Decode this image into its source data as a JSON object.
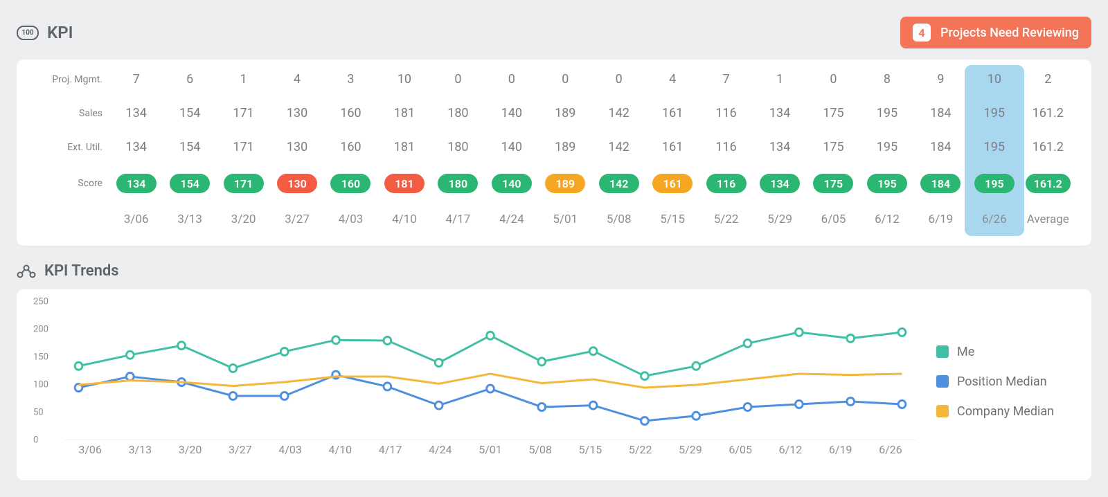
{
  "kpi_header": {
    "badge_text": "100",
    "title": "KPI"
  },
  "review": {
    "count": 4,
    "label": "Projects Need Reviewing"
  },
  "kpi_table": {
    "row_labels": [
      "Proj. Mgmt.",
      "Sales",
      "Ext. Util.",
      "Score",
      ""
    ],
    "dates": [
      "3/06",
      "3/13",
      "3/20",
      "3/27",
      "4/03",
      "4/10",
      "4/17",
      "4/24",
      "5/01",
      "5/08",
      "5/15",
      "5/22",
      "5/29",
      "6/05",
      "6/12",
      "6/19",
      "6/26"
    ],
    "average_label": "Average",
    "highlight_col": 16,
    "proj_mgmt": [
      7,
      6,
      1,
      4,
      3,
      10,
      0,
      0,
      0,
      0,
      4,
      7,
      1,
      0,
      8,
      9,
      10
    ],
    "proj_mgmt_avg": 2,
    "sales": [
      134,
      154,
      171,
      130,
      160,
      181,
      180,
      140,
      189,
      142,
      161,
      116,
      134,
      175,
      195,
      184,
      195
    ],
    "sales_avg": 161.2,
    "ext_util": [
      134,
      154,
      171,
      130,
      160,
      181,
      180,
      140,
      189,
      142,
      161,
      116,
      134,
      175,
      195,
      184,
      195
    ],
    "ext_util_avg": 161.2,
    "score": [
      {
        "v": 134,
        "c": "green"
      },
      {
        "v": 154,
        "c": "green"
      },
      {
        "v": 171,
        "c": "green"
      },
      {
        "v": 130,
        "c": "red"
      },
      {
        "v": 160,
        "c": "green"
      },
      {
        "v": 181,
        "c": "red"
      },
      {
        "v": 180,
        "c": "green"
      },
      {
        "v": 140,
        "c": "green"
      },
      {
        "v": 189,
        "c": "amber"
      },
      {
        "v": 142,
        "c": "green"
      },
      {
        "v": 161,
        "c": "amber"
      },
      {
        "v": 116,
        "c": "green"
      },
      {
        "v": 134,
        "c": "green"
      },
      {
        "v": 175,
        "c": "green"
      },
      {
        "v": 195,
        "c": "green"
      },
      {
        "v": 184,
        "c": "green"
      },
      {
        "v": 195,
        "c": "green"
      }
    ],
    "score_avg": {
      "v": 161.2,
      "c": "green"
    }
  },
  "trends_header": {
    "title": "KPI Trends"
  },
  "legend": {
    "me": "Me",
    "pos": "Position Median",
    "comp": "Company Median"
  },
  "chart_data": {
    "type": "line",
    "title": "KPI Trends",
    "xlabel": "",
    "ylabel": "",
    "ylim": [
      0,
      250
    ],
    "yticks": [
      0,
      50,
      100,
      150,
      200,
      250
    ],
    "categories": [
      "3/06",
      "3/13",
      "3/20",
      "3/27",
      "4/03",
      "4/10",
      "4/17",
      "4/24",
      "5/01",
      "5/08",
      "5/15",
      "5/22",
      "5/29",
      "6/05",
      "6/12",
      "6/19",
      "6/26"
    ],
    "series": [
      {
        "name": "Me",
        "color": "#41bfa4",
        "markers": true,
        "values": [
          134,
          154,
          171,
          130,
          160,
          181,
          180,
          140,
          189,
          142,
          161,
          116,
          134,
          175,
          195,
          184,
          195
        ]
      },
      {
        "name": "Position Median",
        "color": "#4f8fe0",
        "markers": true,
        "values": [
          95,
          115,
          105,
          80,
          80,
          118,
          97,
          63,
          93,
          60,
          63,
          35,
          44,
          60,
          65,
          70,
          65
        ]
      },
      {
        "name": "Company Median",
        "color": "#f4b63b",
        "markers": false,
        "values": [
          100,
          108,
          105,
          98,
          105,
          115,
          115,
          102,
          120,
          103,
          110,
          95,
          100,
          110,
          120,
          118,
          120
        ]
      }
    ]
  }
}
